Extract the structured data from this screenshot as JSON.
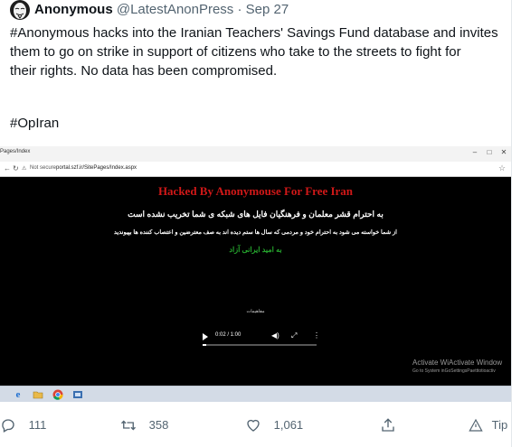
{
  "tweet": {
    "author_name": "Anonymous",
    "handle": "@LatestAnonPress",
    "separator": "·",
    "date": "Sep 27",
    "text_line1": "#Anonymous hacks into the Iranian Teachers' Savings Fund database and invites",
    "text_line2": "them to go on strike in support of citizens who take to the streets to fight for",
    "text_line3": "their rights.  No data has been compromised.",
    "hashtag": "#OpIran"
  },
  "screenshot": {
    "tab_title": "Pages/Index",
    "addr_secure": "Not secure",
    "addr_url": "portal.szf.ir/SitePages/Index.aspx",
    "hack_title": "Hacked By Anonymouse For Free Iran",
    "fa_line1": "به احترام قشر معلمان و فرهنگیان فایل های شبکه ی شما تخریب نشده است",
    "fa_line2": "از شما خواسته می شود به احترام خود و مردمی که سال ها ستم دیده اند به صف معترضین و اعتصاب کننده ها بپیوندید",
    "fa_line3": "به امید ایرانی آزاد",
    "video_label": "مفاهیمات",
    "video_time": "0:02 / 1:00",
    "video_progress": 0.03,
    "activate_line1": "Activate WiActivate Window",
    "activate_line2": "Go to System inGoSettingsPaetttotioactiv"
  },
  "actions": {
    "reply_count": "111",
    "retweet_count": "358",
    "like_count": "1,061",
    "tip_label": "Tip"
  },
  "colors": {
    "text": "#0f1419",
    "secondary": "#536471",
    "hack_red": "#d11818",
    "hack_green": "#26a82e"
  }
}
